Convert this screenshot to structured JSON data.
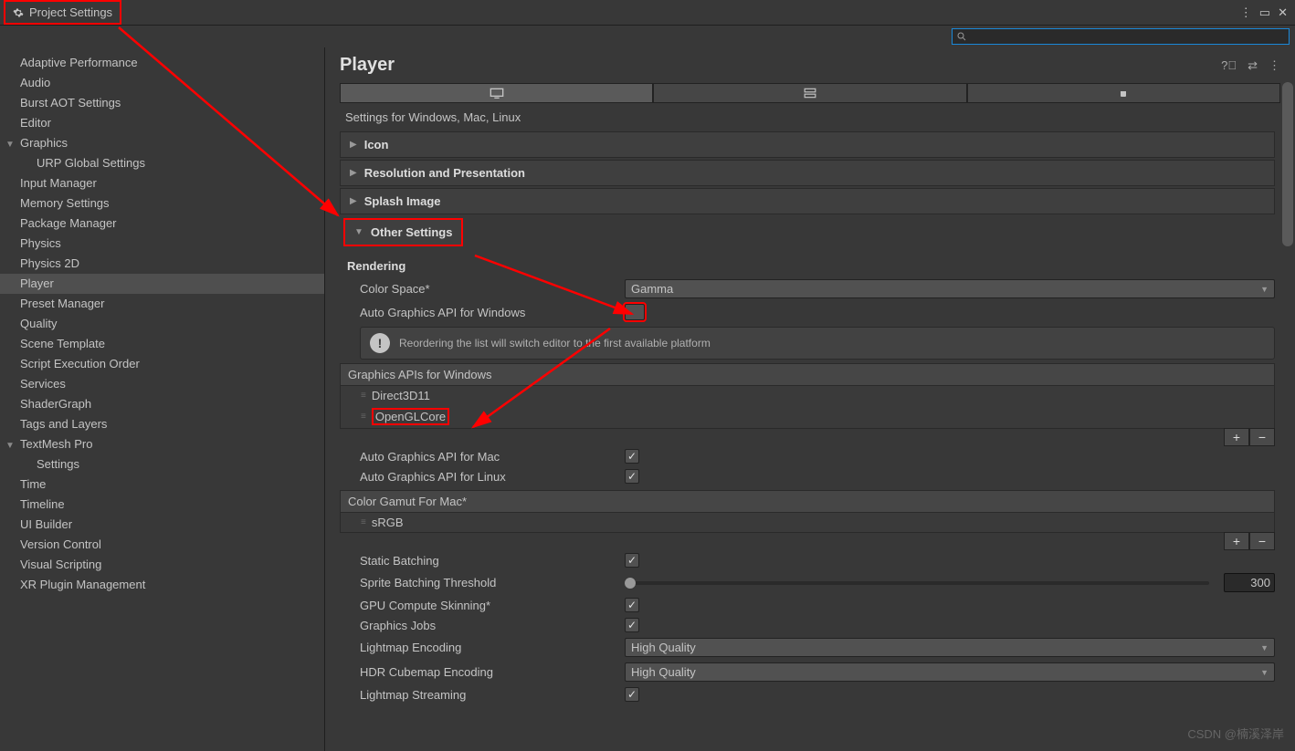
{
  "window": {
    "title": "Project Settings"
  },
  "sidebar": {
    "items": [
      {
        "label": "Adaptive Performance"
      },
      {
        "label": "Audio"
      },
      {
        "label": "Burst AOT Settings"
      },
      {
        "label": "Editor"
      },
      {
        "label": "Graphics",
        "expanded": true
      },
      {
        "label": "URP Global Settings",
        "child": true
      },
      {
        "label": "Input Manager"
      },
      {
        "label": "Memory Settings"
      },
      {
        "label": "Package Manager"
      },
      {
        "label": "Physics"
      },
      {
        "label": "Physics 2D"
      },
      {
        "label": "Player",
        "selected": true
      },
      {
        "label": "Preset Manager"
      },
      {
        "label": "Quality"
      },
      {
        "label": "Scene Template"
      },
      {
        "label": "Script Execution Order"
      },
      {
        "label": "Services"
      },
      {
        "label": "ShaderGraph"
      },
      {
        "label": "Tags and Layers"
      },
      {
        "label": "TextMesh Pro",
        "expanded": true
      },
      {
        "label": "Settings",
        "child": true
      },
      {
        "label": "Time"
      },
      {
        "label": "Timeline"
      },
      {
        "label": "UI Builder"
      },
      {
        "label": "Version Control"
      },
      {
        "label": "Visual Scripting"
      },
      {
        "label": "XR Plugin Management"
      }
    ]
  },
  "header": {
    "title": "Player"
  },
  "platform_title": "Settings for Windows, Mac, Linux",
  "sections": {
    "icon": "Icon",
    "resolution": "Resolution and Presentation",
    "splash": "Splash Image",
    "other": "Other Settings"
  },
  "rendering": {
    "heading": "Rendering",
    "color_space_label": "Color Space*",
    "color_space_value": "Gamma",
    "auto_api_win_label": "Auto Graphics API  for Windows",
    "auto_api_win_checked": false,
    "reorder_msg": "Reordering the list will switch editor to the first available platform",
    "apis_header": "Graphics APIs for Windows",
    "apis": [
      "Direct3D11",
      "OpenGLCore"
    ],
    "auto_api_mac_label": "Auto Graphics API  for Mac",
    "auto_api_linux_label": "Auto Graphics API  for Linux",
    "gamut_header": "Color Gamut For Mac*",
    "gamut_items": [
      "sRGB"
    ],
    "static_batch_label": "Static Batching",
    "sprite_thresh_label": "Sprite Batching Threshold",
    "sprite_thresh_value": "300",
    "gpu_skin_label": "GPU Compute Skinning*",
    "gfx_jobs_label": "Graphics Jobs",
    "lightmap_enc_label": "Lightmap Encoding",
    "lightmap_enc_value": "High Quality",
    "hdr_enc_label": "HDR Cubemap Encoding",
    "hdr_enc_value": "High Quality",
    "lightmap_stream_label": "Lightmap Streaming"
  },
  "footer_btns": {
    "add": "+",
    "remove": "−"
  },
  "watermark": "CSDN @楠溪泽岸"
}
